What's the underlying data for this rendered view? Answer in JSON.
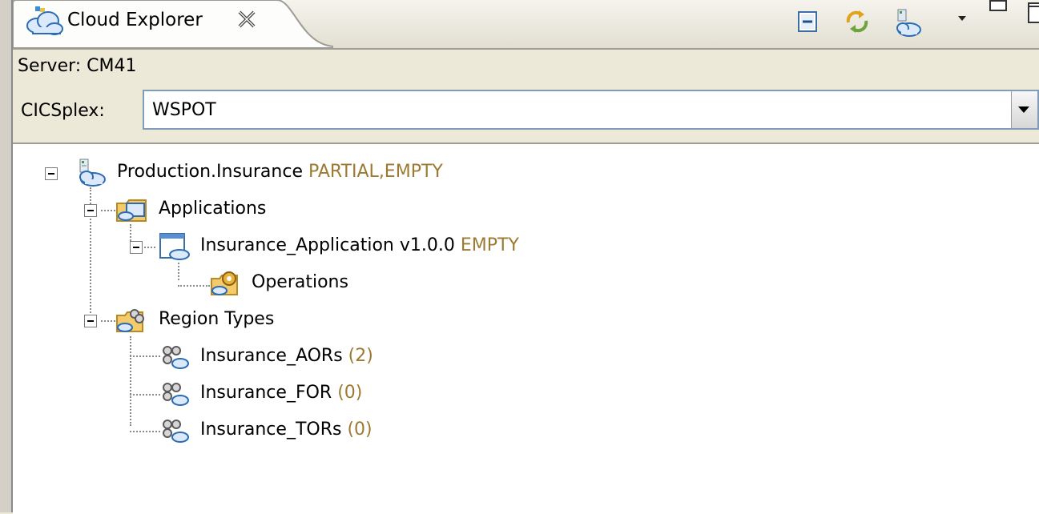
{
  "view": {
    "tab_title": "Cloud Explorer",
    "server_text": "Server: CM41",
    "cicsplex_label": "CICSplex:",
    "cicsplex_value": "WSPOT"
  },
  "toolbar": {
    "icons": [
      "collapse-all-icon",
      "refresh-icon",
      "platform-icon",
      "view-menu-icon",
      "minimize-icon",
      "maximize-icon"
    ]
  },
  "tree": {
    "platform": {
      "label": "Production.Insurance",
      "status": "PARTIAL,EMPTY"
    },
    "applications": {
      "label": "Applications"
    },
    "application": {
      "label": "Insurance_Application v1.0.0",
      "status": "EMPTY"
    },
    "operations": {
      "label": "Operations"
    },
    "region_types": {
      "label": "Region Types"
    },
    "region_type_items": [
      {
        "label": "Insurance_AORs",
        "count": "(2)"
      },
      {
        "label": "Insurance_FOR",
        "count": "(0)"
      },
      {
        "label": "Insurance_TORs",
        "count": "(0)"
      }
    ]
  },
  "colors": {
    "status_text": "#9c7a32",
    "panel_background": "#ece9d8",
    "tree_background": "#ffffff"
  }
}
